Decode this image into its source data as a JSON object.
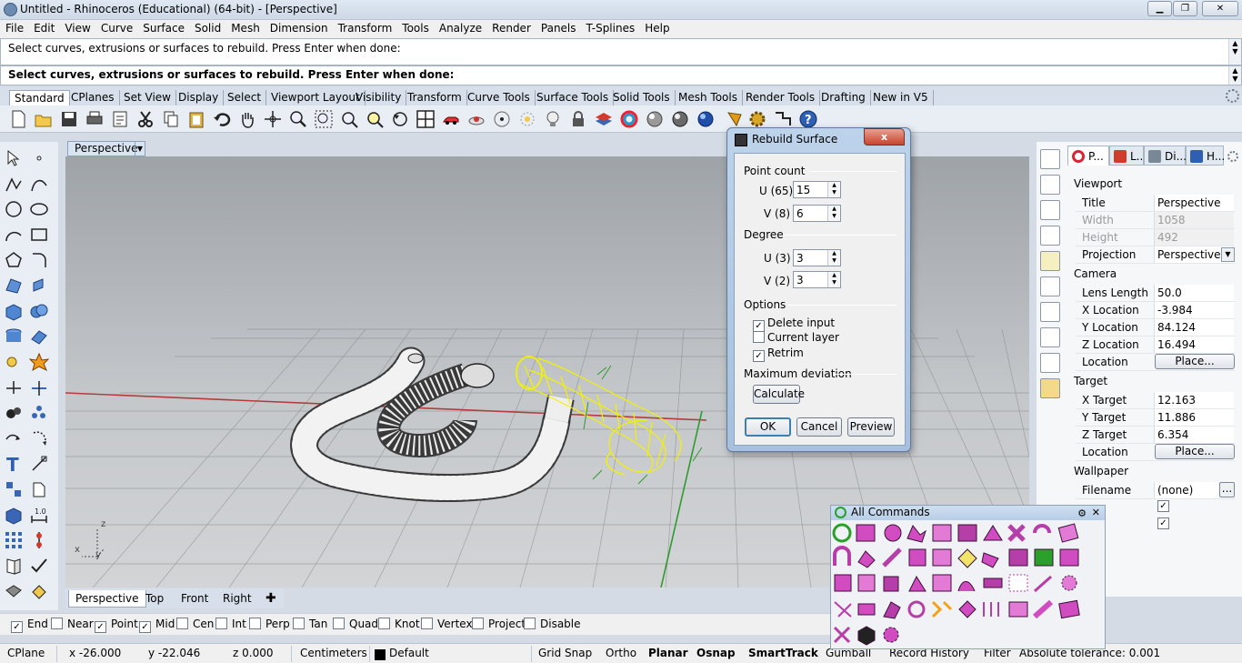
{
  "window": {
    "title": "Untitled - Rhinoceros (Educational) (64-bit) - [Perspective]"
  },
  "menu": [
    "File",
    "Edit",
    "View",
    "Curve",
    "Surface",
    "Solid",
    "Mesh",
    "Dimension",
    "Transform",
    "Tools",
    "Analyze",
    "Render",
    "Panels",
    "T-Splines",
    "Help"
  ],
  "command": {
    "history": "Select curves, extrusions or surfaces to rebuild. Press Enter when done:",
    "prompt": "Select curves, extrusions or surfaces to rebuild. Press Enter when done:"
  },
  "toolbar_tabs": [
    "Standard",
    "CPlanes",
    "Set View",
    "Display",
    "Select",
    "Viewport Layout",
    "Visibility",
    "Transform",
    "Curve Tools",
    "Surface Tools",
    "Solid Tools",
    "Mesh Tools",
    "Render Tools",
    "Drafting",
    "New in V5"
  ],
  "viewport": {
    "title": "Perspective",
    "tabs": [
      "Perspective",
      "Top",
      "Front",
      "Right"
    ],
    "axes": {
      "z": "z",
      "x": "x",
      "y": "y"
    }
  },
  "osnap": {
    "items": [
      {
        "label": "End",
        "checked": true
      },
      {
        "label": "Near",
        "checked": false
      },
      {
        "label": "Point",
        "checked": true
      },
      {
        "label": "Mid",
        "checked": true
      },
      {
        "label": "Cen",
        "checked": false
      },
      {
        "label": "Int",
        "checked": false
      },
      {
        "label": "Perp",
        "checked": false
      },
      {
        "label": "Tan",
        "checked": false
      },
      {
        "label": "Quad",
        "checked": false
      },
      {
        "label": "Knot",
        "checked": false
      },
      {
        "label": "Vertex",
        "checked": false
      },
      {
        "label": "Project",
        "checked": false
      },
      {
        "label": "Disable",
        "checked": false
      }
    ]
  },
  "status": {
    "cplane": "CPlane",
    "x": "x -26.000",
    "y": "y -22.046",
    "z": "z 0.000",
    "units": "Centimeters",
    "layer": "Default",
    "grid_snap": "Grid Snap",
    "ortho": "Ortho",
    "planar": "Planar",
    "osnap": "Osnap",
    "smarttrack": "SmartTrack",
    "gumball": "Gumball",
    "record_history": "Record History",
    "filter": "Filter",
    "tolerance": "Absolute tolerance: 0.001"
  },
  "dialog": {
    "title": "Rebuild Surface",
    "close": "x",
    "point_count_label": "Point count",
    "u_count_label": "U (65)",
    "u_count": "15",
    "v_count_label": "V (8)",
    "v_count": "6",
    "degree_label": "Degree",
    "u_degree_label": "U (3)",
    "u_degree": "3",
    "v_degree_label": "V (2)",
    "v_degree": "3",
    "options_label": "Options",
    "delete_input": "Delete input",
    "current_layer": "Current layer",
    "retrim": "Retrim",
    "max_dev_label": "Maximum deviation",
    "calculate": "Calculate",
    "ok": "OK",
    "cancel": "Cancel",
    "preview": "Preview"
  },
  "properties": {
    "tabs": [
      "P...",
      "L...",
      "Di...",
      "H..."
    ],
    "viewport_section": "Viewport",
    "title_k": "Title",
    "title_v": "Perspective",
    "width_k": "Width",
    "width_v": "1058",
    "height_k": "Height",
    "height_v": "492",
    "projection_k": "Projection",
    "projection_v": "Perspective",
    "camera_section": "Camera",
    "lens_k": "Lens Length",
    "lens_v": "50.0",
    "xloc_k": "X Location",
    "xloc_v": "-3.984",
    "yloc_k": "Y Location",
    "yloc_v": "84.124",
    "zloc_k": "Z Location",
    "zloc_v": "16.494",
    "loc_k": "Location",
    "place": "Place...",
    "target_section": "Target",
    "xt_k": "X Target",
    "xt_v": "12.163",
    "yt_k": "Y Target",
    "yt_v": "11.886",
    "zt_k": "Z Target",
    "zt_v": "6.354",
    "tloc_k": "Location",
    "wallpaper_section": "Wallpaper",
    "filename_k": "Filename",
    "filename_v": "(none)",
    "dots": "..."
  },
  "all_commands": {
    "title": "All Commands"
  },
  "colors": {
    "selection": "#f2f200",
    "grid_red": "#b33c3c",
    "grid_green": "#2f9a2f"
  }
}
